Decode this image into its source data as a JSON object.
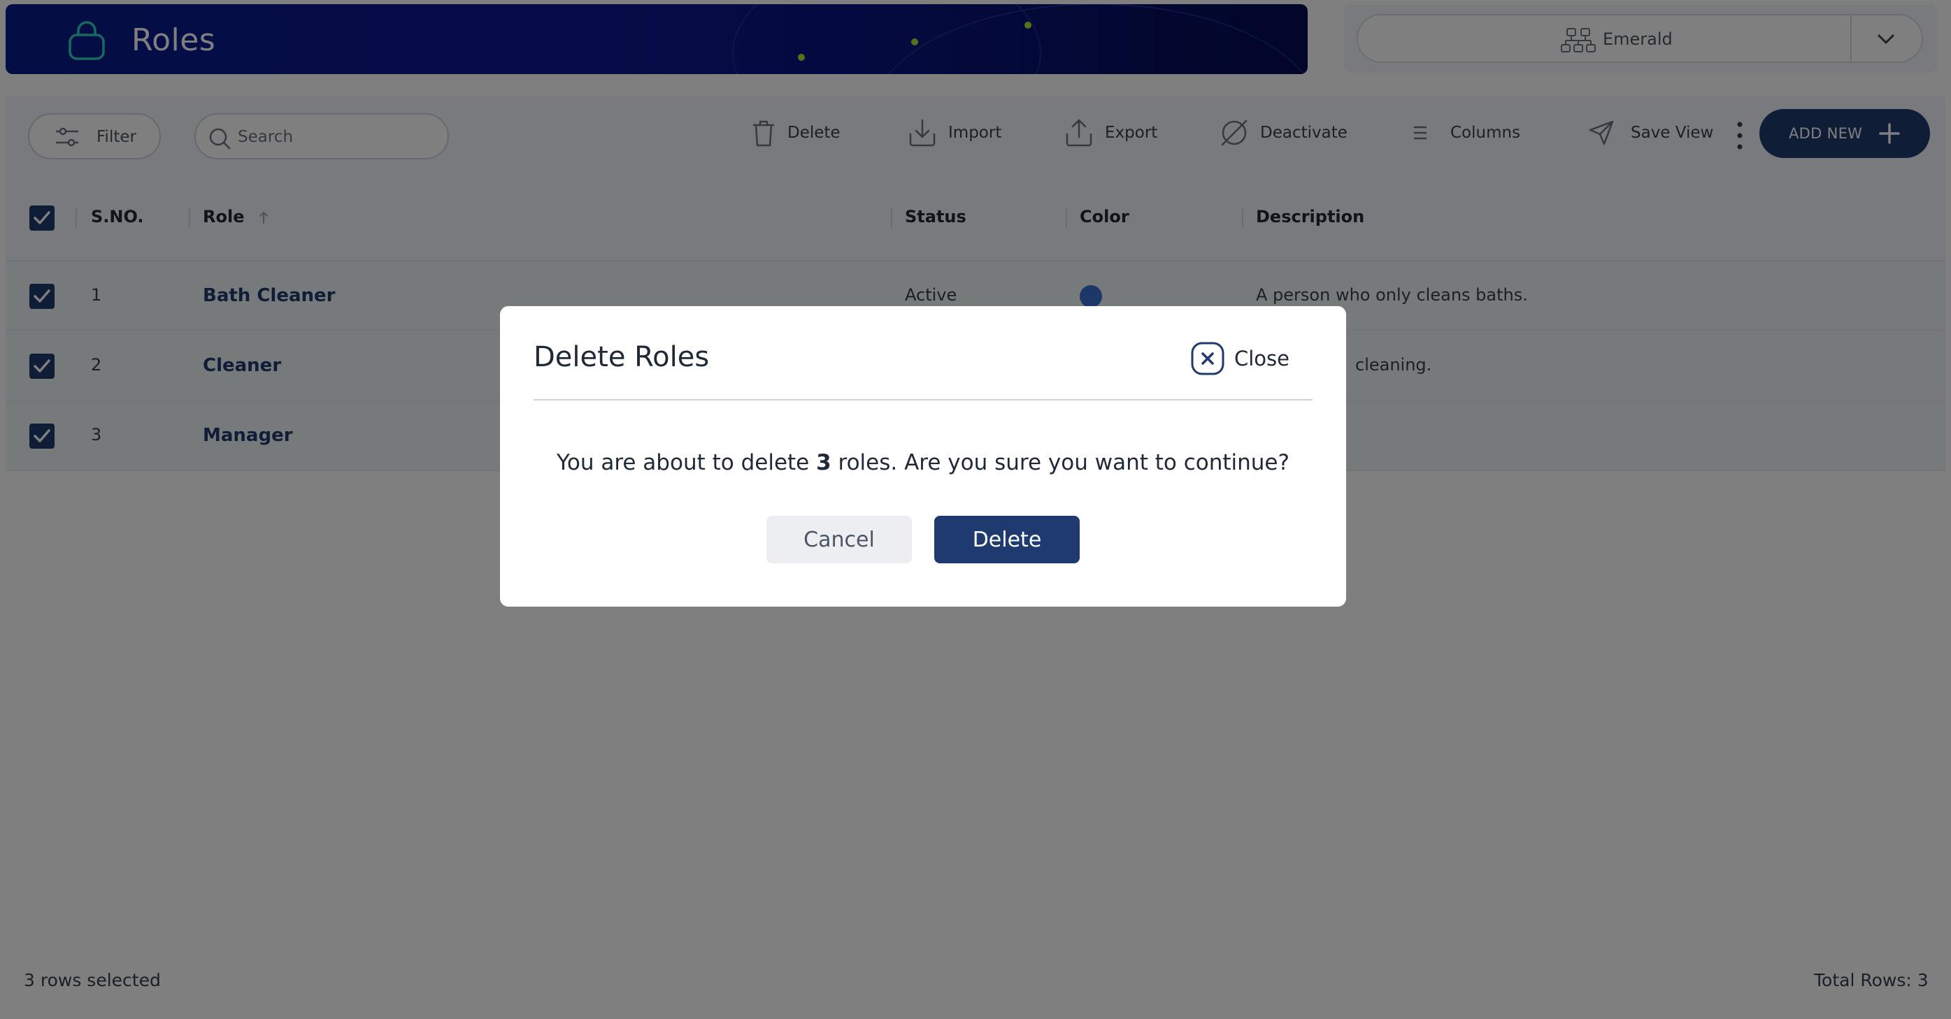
{
  "header": {
    "title": "Roles",
    "icon": "shopping-bag-icon",
    "brand_color": "#0a1b8a"
  },
  "org_selector": {
    "value": "Emerald",
    "icon": "org-chart-icon"
  },
  "toolbar": {
    "filter_label": "Filter",
    "search_placeholder": "Search",
    "delete_label": "Delete",
    "import_label": "Import",
    "export_label": "Export",
    "deactivate_label": "Deactivate",
    "columns_label": "Columns",
    "save_view_label": "Save View",
    "add_new_label": "ADD NEW"
  },
  "table": {
    "columns": [
      "S.NO.",
      "Role",
      "Status",
      "Color",
      "Description"
    ],
    "sort": {
      "column": "Role",
      "direction": "asc"
    },
    "rows": [
      {
        "sno": "1",
        "role": "Bath Cleaner",
        "status": "Active",
        "color": "#3b6fd1",
        "description": "A person who only cleans baths.",
        "selected": true
      },
      {
        "sno": "2",
        "role": "Cleaner",
        "status": "",
        "color": "",
        "description": "cleaning.",
        "selected": true
      },
      {
        "sno": "3",
        "role": "Manager",
        "status": "",
        "color": "",
        "description": "",
        "selected": true
      }
    ]
  },
  "footer": {
    "selected_text": "3 rows selected",
    "total_text": "Total Rows: 3"
  },
  "modal": {
    "title": "Delete Roles",
    "close_label": "Close",
    "message_prefix": "You are about to delete ",
    "message_count": "3",
    "message_suffix": " roles. Are you sure you want to continue?",
    "cancel_label": "Cancel",
    "confirm_label": "Delete"
  },
  "colors": {
    "accent": "#1f3a6f",
    "row_highlight": "#eef5f4",
    "header_bg": "#f1f4fa"
  }
}
